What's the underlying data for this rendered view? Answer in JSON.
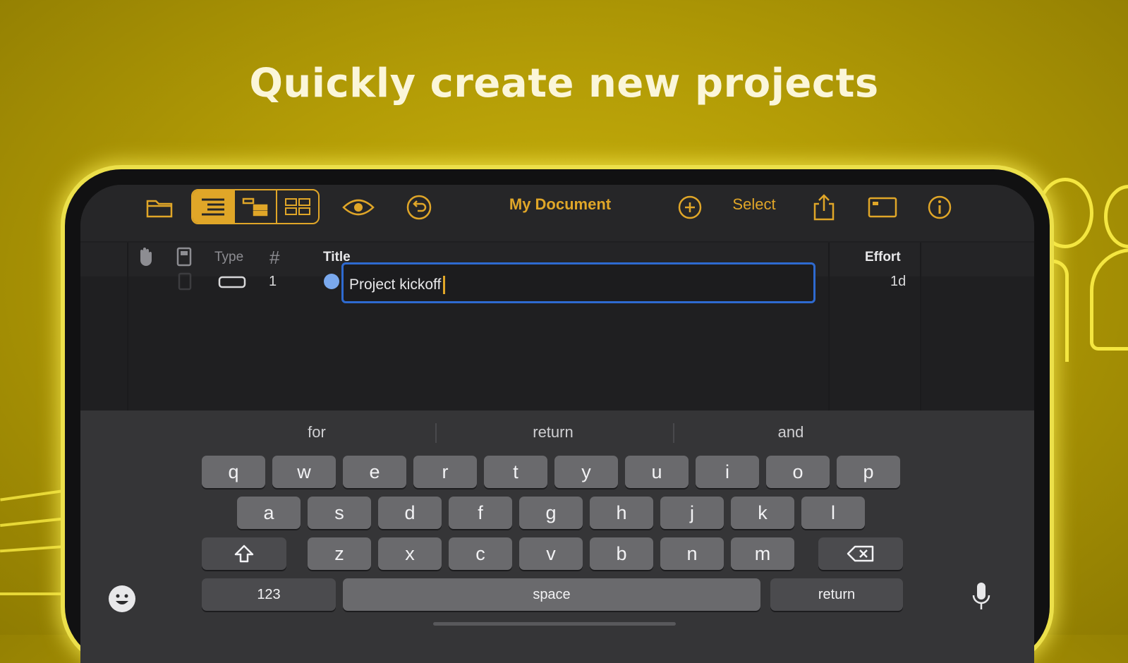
{
  "headline": "Quickly create new projects",
  "toolbar": {
    "document_title": "My Document",
    "select_label": "Select"
  },
  "columns": {
    "type": "Type",
    "number": "#",
    "title": "Title",
    "effort": "Effort"
  },
  "rows": [
    {
      "number": "1",
      "title": "Project kickoff",
      "effort": "1d"
    }
  ],
  "keyboard": {
    "suggestions": [
      "for",
      "return",
      "and"
    ],
    "row1": [
      "q",
      "w",
      "e",
      "r",
      "t",
      "y",
      "u",
      "i",
      "o",
      "p"
    ],
    "row2": [
      "a",
      "s",
      "d",
      "f",
      "g",
      "h",
      "j",
      "k",
      "l"
    ],
    "row3": [
      "z",
      "x",
      "c",
      "v",
      "b",
      "n",
      "m"
    ],
    "numbers_label": "123",
    "space_label": "space",
    "return_label": "return"
  },
  "colors": {
    "accent": "#e0a628",
    "selection_border": "#2e6ad0",
    "task_dot": "#7aa9ee",
    "background": "#b39c06"
  }
}
